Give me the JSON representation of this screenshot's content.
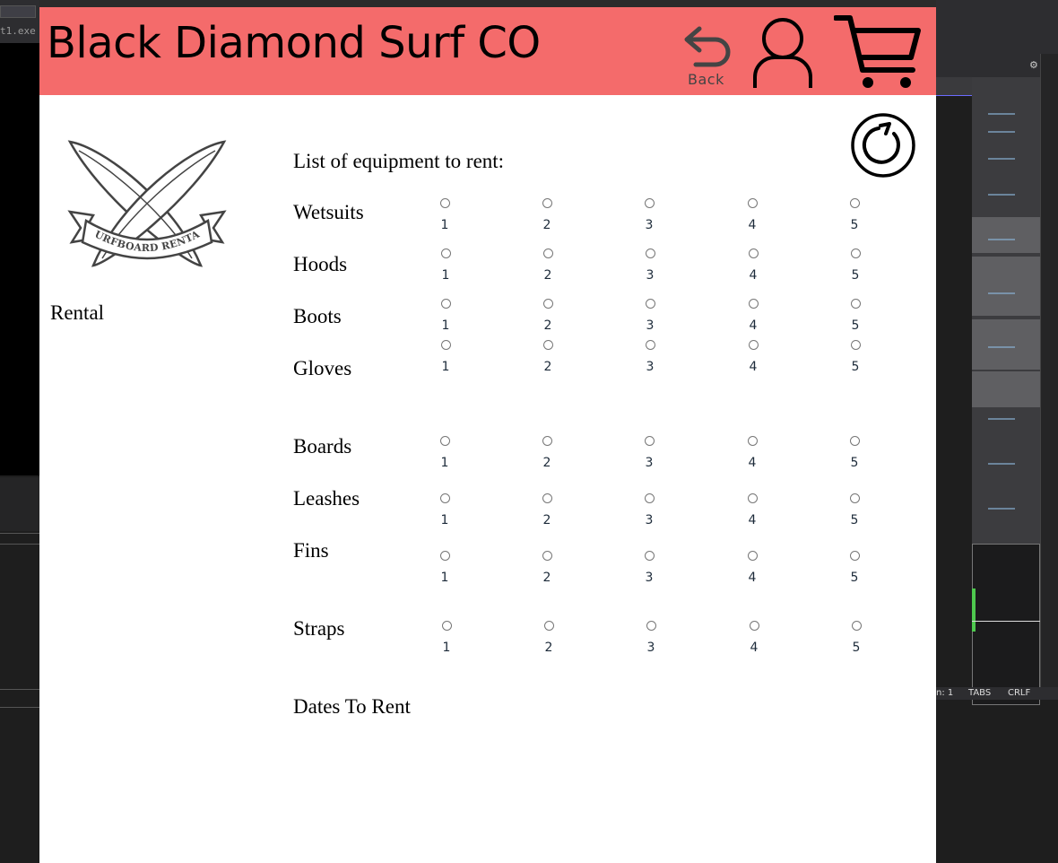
{
  "ide": {
    "file_tab": "t1.exe",
    "status_left": "n: 1",
    "status_tabs": "TABS",
    "status_eol": "CRLF"
  },
  "header": {
    "brand_title": "Black Diamond Surf CO",
    "back_label": "Back",
    "bg_color": "#f46b6b"
  },
  "icons": {
    "back": "back-arrow-icon",
    "user": "user-icon",
    "cart": "cart-icon",
    "refresh": "refresh-icon"
  },
  "sidebar": {
    "logo_text": "SURFBOARD RENTAL",
    "caption": "Rental"
  },
  "form": {
    "title": "List of equipment to rent:",
    "quantity_options": [
      "1",
      "2",
      "3",
      "4",
      "5"
    ],
    "items": [
      {
        "label": "Wetsuits"
      },
      {
        "label": "Hoods"
      },
      {
        "label": "Boots"
      },
      {
        "label": "Gloves"
      },
      {
        "label": "Boards"
      },
      {
        "label": "Leashes"
      },
      {
        "label": "Fins"
      },
      {
        "label": "Straps"
      }
    ],
    "dates_label": "Dates To Rent"
  }
}
